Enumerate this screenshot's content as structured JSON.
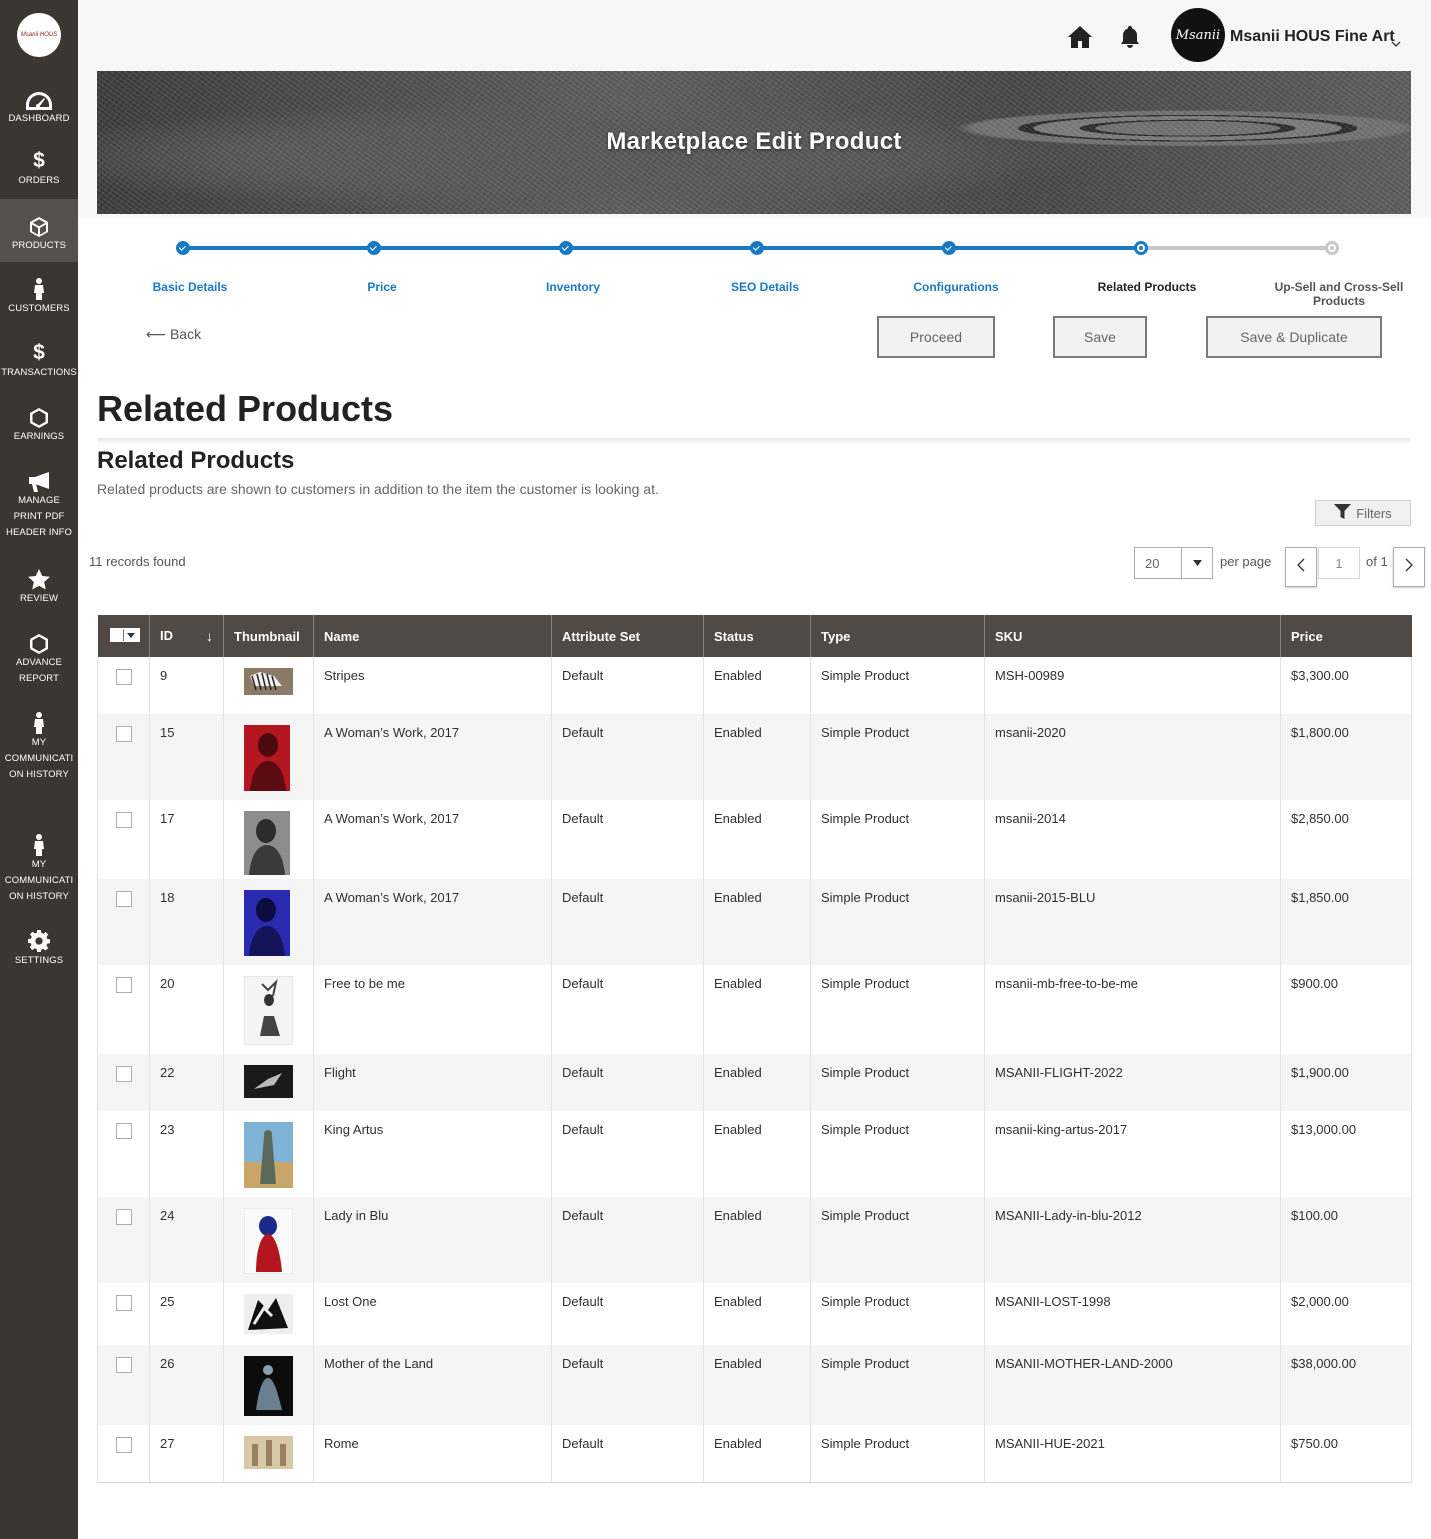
{
  "sidebar": {
    "logo_text": "Msanii HOUS",
    "items": [
      {
        "label": "DASHBOARD",
        "icon": "dashboard-icon"
      },
      {
        "label": "ORDERS",
        "icon": "dollar-icon"
      },
      {
        "label": "PRODUCTS",
        "icon": "box-icon"
      },
      {
        "label": "CUSTOMERS",
        "icon": "person-icon"
      },
      {
        "label": "TRANSACTIONS",
        "icon": "dollar-icon"
      },
      {
        "label": "EARNINGS",
        "icon": "hexagon-icon"
      },
      {
        "label": "MANAGE PRINT PDF HEADER INFO",
        "icon": "megaphone-icon"
      },
      {
        "label": "REVIEW",
        "icon": "star-icon"
      },
      {
        "label": "ADVANCE REPORT",
        "icon": "hexagon-icon"
      },
      {
        "label": "MY COMMUNICATI ON HISTORY",
        "icon": "person-icon"
      },
      {
        "label": "MY COMMUNICATI ON HISTORY",
        "icon": "person-icon"
      },
      {
        "label": "SETTINGS",
        "icon": "gear-icon"
      }
    ]
  },
  "header": {
    "store_name": "Msanii HOUS Fine Art",
    "avatar_text": "Msanii"
  },
  "banner": {
    "title": "Marketplace Edit Product"
  },
  "stepper": {
    "accent": "#1979c3",
    "steps": [
      {
        "label": "Basic Details",
        "state": "done"
      },
      {
        "label": "Price",
        "state": "done"
      },
      {
        "label": "Inventory",
        "state": "done"
      },
      {
        "label": "SEO Details",
        "state": "done"
      },
      {
        "label": "Configurations",
        "state": "done"
      },
      {
        "label": "Related Products",
        "state": "current"
      },
      {
        "label": "Up-Sell and Cross-Sell Products",
        "state": "todo"
      }
    ]
  },
  "actions": {
    "back": "Back",
    "proceed": "Proceed",
    "save": "Save",
    "save_duplicate": "Save & Duplicate"
  },
  "page": {
    "title": "Related Products",
    "section_title": "Related Products",
    "section_desc": "Related products are shown to customers in addition to the item the customer is looking at."
  },
  "grid_controls": {
    "filters": "Filters",
    "records": "11 records found",
    "per_page_value": "20",
    "per_page_label": "per page",
    "page_value": "1",
    "page_of": "of 1"
  },
  "table": {
    "header_bg": "#514943",
    "columns": [
      "ID",
      "Thumbnail",
      "Name",
      "Attribute Set",
      "Status",
      "Type",
      "SKU",
      "Price"
    ],
    "rows": [
      {
        "id": "9",
        "name": "Stripes",
        "attr": "Default",
        "status": "Enabled",
        "type": "Simple Product",
        "sku": "MSH-00989",
        "price": "$3,300.00"
      },
      {
        "id": "15",
        "name": "A Woman’s Work, 2017",
        "attr": "Default",
        "status": "Enabled",
        "type": "Simple Product",
        "sku": "msanii-2020",
        "price": "$1,800.00"
      },
      {
        "id": "17",
        "name": "A Woman’s Work, 2017",
        "attr": "Default",
        "status": "Enabled",
        "type": "Simple Product",
        "sku": "msanii-2014",
        "price": "$2,850.00"
      },
      {
        "id": "18",
        "name": "A Woman’s Work, 2017",
        "attr": "Default",
        "status": "Enabled",
        "type": "Simple Product",
        "sku": "msanii-2015-BLU",
        "price": "$1,850.00"
      },
      {
        "id": "20",
        "name": "Free to be me",
        "attr": "Default",
        "status": "Enabled",
        "type": "Simple Product",
        "sku": "msanii-mb-free-to-be-me",
        "price": "$900.00"
      },
      {
        "id": "22",
        "name": "Flight",
        "attr": "Default",
        "status": "Enabled",
        "type": "Simple Product",
        "sku": "MSANII-FLIGHT-2022",
        "price": "$1,900.00"
      },
      {
        "id": "23",
        "name": "King Artus",
        "attr": "Default",
        "status": "Enabled",
        "type": "Simple Product",
        "sku": "msanii-king-artus-2017",
        "price": "$13,000.00"
      },
      {
        "id": "24",
        "name": "Lady in Blu",
        "attr": "Default",
        "status": "Enabled",
        "type": "Simple Product",
        "sku": "MSANII-Lady-in-blu-2012",
        "price": "$100.00"
      },
      {
        "id": "25",
        "name": "Lost One",
        "attr": "Default",
        "status": "Enabled",
        "type": "Simple Product",
        "sku": "MSANII-LOST-1998",
        "price": "$2,000.00"
      },
      {
        "id": "26",
        "name": "Mother of the Land",
        "attr": "Default",
        "status": "Enabled",
        "type": "Simple Product",
        "sku": "MSANII-MOTHER-LAND-2000",
        "price": "$38,000.00"
      },
      {
        "id": "27",
        "name": "Rome",
        "attr": "Default",
        "status": "Enabled",
        "type": "Simple Product",
        "sku": "MSANII-HUE-2021",
        "price": "$750.00"
      }
    ]
  }
}
